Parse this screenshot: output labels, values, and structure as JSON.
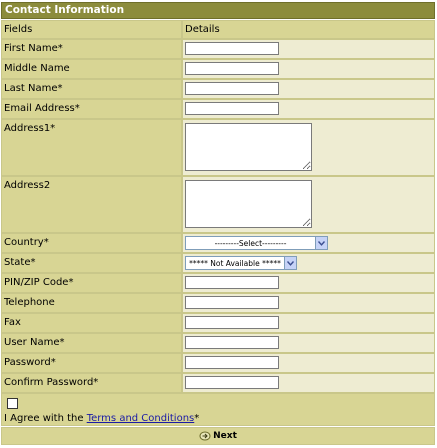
{
  "form": {
    "title": "Contact Information",
    "col_fields": "Fields",
    "col_details": "Details"
  },
  "fields": {
    "first_name": "First Name*",
    "middle_name": "Middle Name",
    "last_name": "Last Name*",
    "email": "Email Address*",
    "address1": "Address1*",
    "address2": "Address2",
    "country": "Country*",
    "state": "State*",
    "pin": "PIN/ZIP Code*",
    "telephone": "Telephone",
    "fax": "Fax",
    "user_name": "User Name*",
    "password": "Password*",
    "confirm_password": "Confirm Password*"
  },
  "selects": {
    "country_selected": "---------Select---------",
    "state_selected": "***** Not Available *****"
  },
  "agree": {
    "prefix": "I Agree with the ",
    "link": "Terms and Conditions",
    "suffix": "*"
  },
  "next_label": "Next",
  "icons": {
    "select_arrow": "chevron-down-icon",
    "next": "next-arrow-icon"
  },
  "colors": {
    "title_bg": "#8c8c3c",
    "label_bg": "#d8d594",
    "detail_bg": "#eeecd2",
    "link": "#1a1aa6"
  }
}
